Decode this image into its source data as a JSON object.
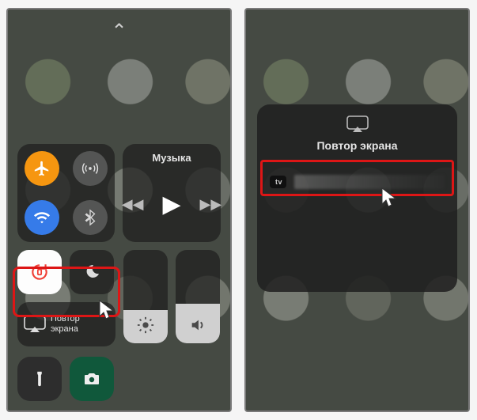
{
  "left": {
    "chevron": "⌄",
    "music": {
      "title": "Музыка"
    },
    "mirror": {
      "line1": "Повтор",
      "line2": "экрана"
    },
    "toggles": {
      "airplane": "airplane-icon",
      "cellular": "cellular-icon",
      "wifi": "wifi-icon",
      "bluetooth": "bluetooth-icon"
    },
    "tiles": {
      "lock": "rotation-lock-icon",
      "dnd": "moon-icon",
      "brightness": "sun-icon",
      "volume": "speaker-icon",
      "flashlight": "flashlight-icon",
      "camera": "camera-icon"
    }
  },
  "right": {
    "sheet_title": "Повтор экрана",
    "device_badge": "tv"
  }
}
